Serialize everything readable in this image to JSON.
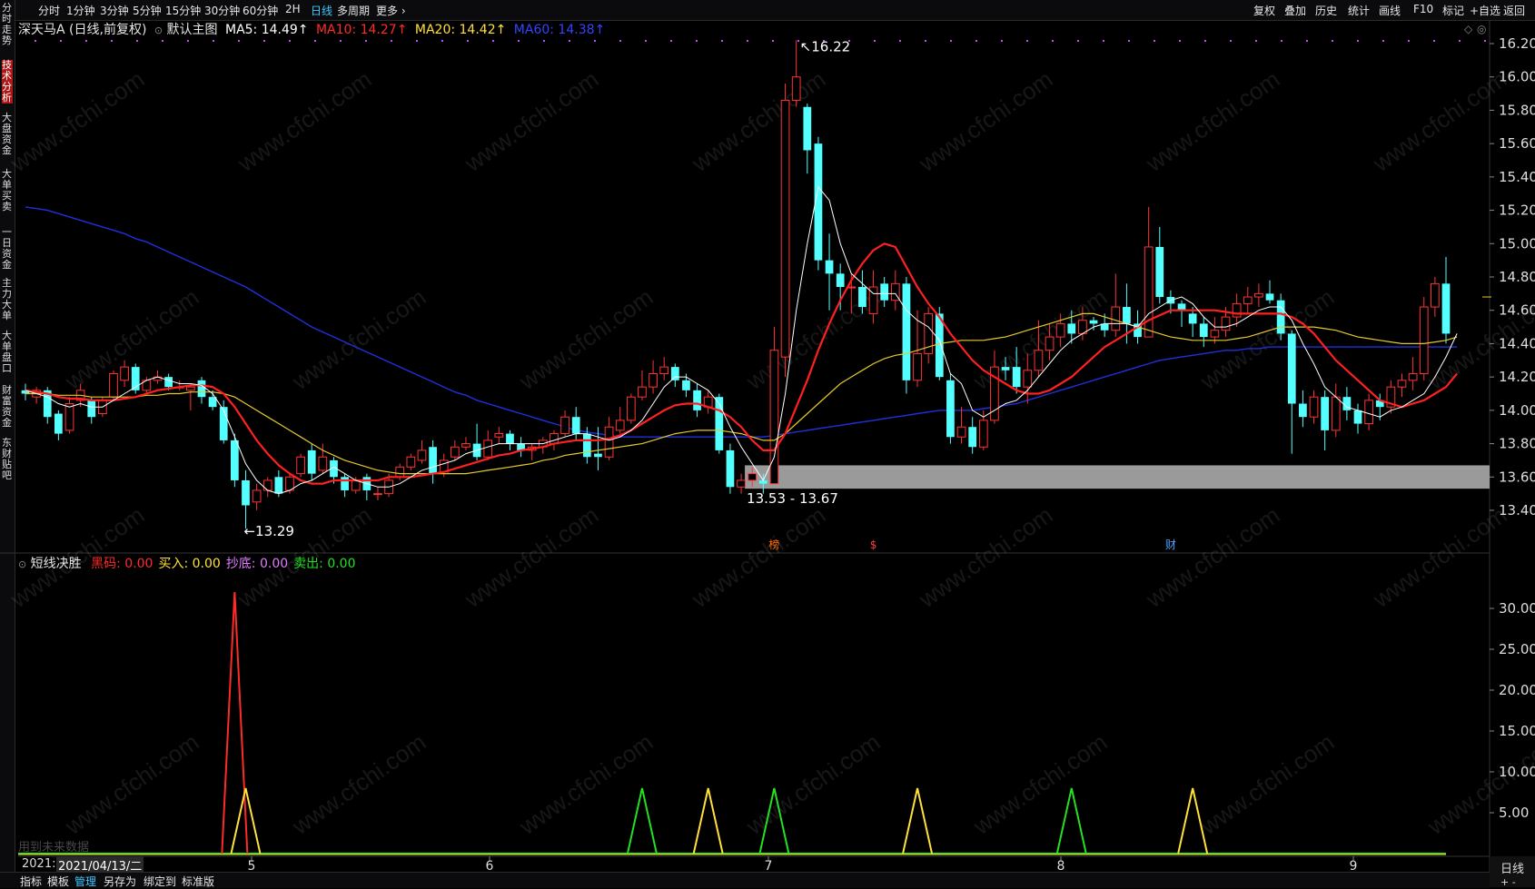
{
  "topbar": {
    "left_items": [
      "分时",
      "1分钟",
      "3分钟",
      "5分钟",
      "15分钟",
      "30分钟",
      "60分钟",
      "2H",
      "日线",
      "多周期",
      "更多"
    ],
    "active": "日线",
    "right_items": [
      "复权",
      "叠加",
      "历史",
      "统计",
      "画线",
      "F10",
      "标记",
      "+自选",
      "返回"
    ]
  },
  "left_tabs": [
    "分时走势",
    "技术分析",
    "大盘资金",
    "大单买卖",
    "一日资金",
    "主力大单",
    "大单盘口",
    "财富资金",
    "东财贴吧"
  ],
  "left_active": "技术分析",
  "main": {
    "stock_label": "深天马A (日线,前复权)",
    "indicator_label": "默认主图",
    "ma": [
      {
        "text": "MA5: 14.49↑",
        "color": "#ffffff"
      },
      {
        "text": "MA10: 14.27↑",
        "color": "#ff2a2a"
      },
      {
        "text": "MA20: 14.42↑",
        "color": "#ffe13a"
      },
      {
        "text": "MA60: 14.38↑",
        "color": "#3344ff"
      }
    ],
    "high_label": "16.22",
    "low_label": "13.29",
    "gap_label": "13.53 - 13.67",
    "badges": [
      {
        "text": "榜",
        "color": "#ff6a00"
      },
      {
        "text": "$",
        "color": "#ff3b3b"
      },
      {
        "text": "财",
        "color": "#4da3ff"
      }
    ]
  },
  "sub": {
    "name": "短线决胜",
    "items": [
      {
        "text": "黑码: 0.00",
        "color": "#ff2a2a"
      },
      {
        "text": "买入: 0.00",
        "color": "#ffe13a"
      },
      {
        "text": "抄底: 0.00",
        "color": "#e07cff"
      },
      {
        "text": "卖出: 0.00",
        "color": "#22e022"
      }
    ],
    "future_note": "用到未来数据"
  },
  "xaxis": {
    "date": "2021/04/13/二",
    "date_prefix": "2021:",
    "months": [
      "5",
      "6",
      "7",
      "8",
      "9"
    ]
  },
  "right_period": "日线",
  "bottom": [
    "指标",
    "模板",
    "管理",
    "另存为",
    "绑定到",
    "标准版"
  ],
  "bottom_selected": "管理",
  "watermark": "www.cfchi.com",
  "chart_data": {
    "type": "candlestick",
    "price_ticks": [
      16.2,
      16.0,
      15.8,
      15.6,
      15.4,
      15.2,
      15.0,
      14.8,
      14.6,
      14.4,
      14.2,
      14.0,
      13.8,
      13.6,
      13.4
    ],
    "sub_ticks": [
      30,
      25,
      20,
      15,
      10,
      5
    ],
    "candles": [
      [
        14.12,
        14.1,
        14.16,
        14.06
      ],
      [
        14.08,
        14.12,
        14.14,
        14.04
      ],
      [
        14.12,
        13.96,
        14.14,
        13.92
      ],
      [
        13.98,
        13.86,
        14.0,
        13.82
      ],
      [
        13.88,
        14.04,
        14.08,
        13.86
      ],
      [
        14.06,
        14.12,
        14.16,
        14.02
      ],
      [
        14.06,
        13.96,
        14.08,
        13.92
      ],
      [
        13.98,
        14.06,
        14.08,
        13.96
      ],
      [
        14.08,
        14.22,
        14.24,
        14.06
      ],
      [
        14.18,
        14.26,
        14.3,
        14.14
      ],
      [
        14.26,
        14.12,
        14.28,
        14.1
      ],
      [
        14.12,
        14.18,
        14.2,
        14.1
      ],
      [
        14.18,
        14.2,
        14.24,
        14.16
      ],
      [
        14.2,
        14.14,
        14.22,
        14.12
      ],
      [
        14.14,
        14.14,
        14.18,
        14.12
      ],
      [
        14.12,
        14.14,
        14.16,
        14.0
      ],
      [
        14.18,
        14.08,
        14.2,
        14.04
      ],
      [
        14.08,
        14.02,
        14.12,
        14.0
      ],
      [
        14.02,
        13.82,
        14.06,
        13.8
      ],
      [
        13.82,
        13.58,
        13.86,
        13.54
      ],
      [
        13.58,
        13.43,
        13.64,
        13.29
      ],
      [
        13.45,
        13.52,
        13.56,
        13.4
      ],
      [
        13.52,
        13.58,
        13.6,
        13.48
      ],
      [
        13.6,
        13.5,
        13.64,
        13.48
      ],
      [
        13.52,
        13.6,
        13.62,
        13.5
      ],
      [
        13.62,
        13.72,
        13.74,
        13.6
      ],
      [
        13.76,
        13.62,
        13.8,
        13.58
      ],
      [
        13.64,
        13.72,
        13.8,
        13.62
      ],
      [
        13.7,
        13.6,
        13.72,
        13.56
      ],
      [
        13.6,
        13.52,
        13.62,
        13.48
      ],
      [
        13.52,
        13.58,
        13.6,
        13.5
      ],
      [
        13.6,
        13.52,
        13.62,
        13.46
      ],
      [
        13.5,
        13.5,
        13.54,
        13.46
      ],
      [
        13.5,
        13.58,
        13.62,
        13.48
      ],
      [
        13.6,
        13.66,
        13.68,
        13.58
      ],
      [
        13.66,
        13.72,
        13.74,
        13.64
      ],
      [
        13.7,
        13.76,
        13.82,
        13.68
      ],
      [
        13.78,
        13.62,
        13.82,
        13.56
      ],
      [
        13.62,
        13.7,
        13.74,
        13.6
      ],
      [
        13.72,
        13.78,
        13.82,
        13.7
      ],
      [
        13.78,
        13.8,
        13.84,
        13.76
      ],
      [
        13.8,
        13.72,
        13.92,
        13.7
      ],
      [
        13.72,
        13.82,
        13.88,
        13.7
      ],
      [
        13.84,
        13.86,
        13.9,
        13.8
      ],
      [
        13.86,
        13.8,
        13.88,
        13.76
      ],
      [
        13.8,
        13.76,
        13.84,
        13.72
      ],
      [
        13.76,
        13.78,
        13.8,
        13.7
      ],
      [
        13.78,
        13.82,
        13.84,
        13.74
      ],
      [
        13.8,
        13.86,
        13.88,
        13.76
      ],
      [
        13.86,
        13.96,
        14.0,
        13.84
      ],
      [
        13.96,
        13.86,
        14.02,
        13.82
      ],
      [
        13.86,
        13.72,
        13.9,
        13.68
      ],
      [
        13.74,
        13.72,
        13.9,
        13.64
      ],
      [
        13.72,
        13.9,
        13.96,
        13.7
      ],
      [
        13.88,
        13.94,
        14.02,
        13.86
      ],
      [
        13.94,
        14.08,
        14.1,
        13.92
      ],
      [
        14.08,
        14.14,
        14.24,
        14.06
      ],
      [
        14.14,
        14.22,
        14.3,
        14.1
      ],
      [
        14.22,
        14.26,
        14.32,
        14.18
      ],
      [
        14.26,
        14.18,
        14.28,
        14.14
      ],
      [
        14.18,
        14.12,
        14.22,
        14.08
      ],
      [
        14.12,
        14.0,
        14.16,
        13.96
      ],
      [
        14.02,
        14.08,
        14.12,
        13.98
      ],
      [
        14.08,
        13.76,
        14.1,
        13.74
      ],
      [
        13.76,
        13.54,
        13.8,
        13.5
      ],
      [
        13.54,
        13.58,
        13.62,
        13.5
      ],
      [
        13.58,
        13.62,
        13.66,
        13.54
      ],
      [
        13.58,
        13.56,
        13.62,
        13.5
      ],
      [
        13.56,
        14.36,
        14.5,
        13.56
      ],
      [
        14.32,
        15.86,
        15.96,
        14.2
      ],
      [
        15.86,
        16.0,
        16.22,
        15.82
      ],
      [
        15.82,
        15.56,
        15.84,
        15.42
      ],
      [
        15.6,
        14.9,
        15.64,
        14.84
      ],
      [
        14.9,
        14.82,
        15.06,
        14.6
      ],
      [
        14.82,
        14.74,
        14.88,
        14.6
      ],
      [
        14.74,
        14.74,
        14.82,
        14.58
      ],
      [
        14.74,
        14.62,
        14.84,
        14.58
      ],
      [
        14.58,
        14.74,
        14.84,
        14.52
      ],
      [
        14.76,
        14.66,
        14.8,
        14.62
      ],
      [
        14.66,
        14.76,
        14.84,
        14.6
      ],
      [
        14.76,
        14.18,
        14.8,
        14.1
      ],
      [
        14.18,
        14.34,
        14.6,
        14.14
      ],
      [
        14.34,
        14.58,
        14.62,
        14.28
      ],
      [
        14.58,
        14.2,
        14.62,
        14.18
      ],
      [
        14.18,
        13.84,
        14.22,
        13.8
      ],
      [
        13.84,
        13.9,
        14.02,
        13.8
      ],
      [
        13.9,
        13.78,
        13.96,
        13.74
      ],
      [
        13.78,
        13.94,
        14.0,
        13.76
      ],
      [
        13.94,
        14.26,
        14.36,
        13.92
      ],
      [
        14.26,
        14.24,
        14.32,
        14.18
      ],
      [
        14.26,
        14.14,
        14.38,
        14.1
      ],
      [
        14.14,
        14.24,
        14.34,
        14.04
      ],
      [
        14.24,
        14.36,
        14.54,
        14.2
      ],
      [
        14.36,
        14.44,
        14.52,
        14.3
      ],
      [
        14.44,
        14.52,
        14.58,
        14.38
      ],
      [
        14.52,
        14.46,
        14.6,
        14.4
      ],
      [
        14.46,
        14.54,
        14.62,
        14.42
      ],
      [
        14.54,
        14.52,
        14.56,
        14.48
      ],
      [
        14.52,
        14.48,
        14.58,
        14.44
      ],
      [
        14.48,
        14.62,
        14.82,
        14.44
      ],
      [
        14.62,
        14.52,
        14.76,
        14.4
      ],
      [
        14.52,
        14.44,
        14.6,
        14.4
      ],
      [
        14.44,
        14.98,
        15.22,
        14.44
      ],
      [
        14.98,
        14.68,
        15.1,
        14.64
      ],
      [
        14.68,
        14.64,
        14.72,
        14.58
      ],
      [
        14.64,
        14.6,
        14.66,
        14.5
      ],
      [
        14.58,
        14.52,
        14.62,
        14.44
      ],
      [
        14.52,
        14.44,
        14.56,
        14.38
      ],
      [
        14.44,
        14.48,
        14.56,
        14.4
      ],
      [
        14.48,
        14.56,
        14.62,
        14.44
      ],
      [
        14.56,
        14.64,
        14.7,
        14.5
      ],
      [
        14.64,
        14.68,
        14.74,
        14.58
      ],
      [
        14.68,
        14.7,
        14.76,
        14.62
      ],
      [
        14.7,
        14.66,
        14.78,
        14.64
      ],
      [
        14.66,
        14.46,
        14.7,
        14.42
      ],
      [
        14.46,
        14.04,
        14.48,
        13.74
      ],
      [
        14.04,
        13.96,
        14.12,
        13.9
      ],
      [
        13.96,
        14.08,
        14.12,
        13.92
      ],
      [
        14.08,
        13.88,
        14.12,
        13.76
      ],
      [
        13.88,
        14.08,
        14.16,
        13.84
      ],
      [
        14.08,
        14.0,
        14.14,
        13.94
      ],
      [
        14.0,
        13.92,
        14.04,
        13.86
      ],
      [
        13.92,
        14.06,
        14.1,
        13.88
      ],
      [
        14.06,
        14.02,
        14.1,
        13.94
      ],
      [
        14.02,
        14.14,
        14.18,
        13.98
      ],
      [
        14.14,
        14.18,
        14.22,
        14.08
      ],
      [
        14.18,
        14.22,
        14.32,
        14.12
      ],
      [
        14.22,
        14.62,
        14.68,
        14.18
      ],
      [
        14.62,
        14.76,
        14.8,
        14.56
      ],
      [
        14.76,
        14.46,
        14.92,
        14.4
      ]
    ],
    "ma5": [
      14.12,
      14.1,
      14.08,
      14.04,
      14.02,
      14.04,
      14.02,
      14.02,
      14.06,
      14.1,
      14.14,
      14.18,
      14.2,
      14.18,
      14.16,
      14.16,
      14.15,
      14.1,
      14.0,
      13.84,
      13.68,
      13.58,
      13.52,
      13.5,
      13.52,
      13.56,
      13.58,
      13.62,
      13.66,
      13.62,
      13.58,
      13.56,
      13.54,
      13.54,
      13.56,
      13.6,
      13.64,
      13.66,
      13.68,
      13.7,
      13.74,
      13.76,
      13.78,
      13.8,
      13.8,
      13.8,
      13.8,
      13.8,
      13.82,
      13.84,
      13.86,
      13.86,
      13.84,
      13.82,
      13.84,
      13.88,
      13.94,
      14.04,
      14.14,
      14.2,
      14.2,
      14.16,
      14.12,
      14.04,
      13.9,
      13.78,
      13.68,
      13.58,
      13.72,
      14.1,
      14.6,
      15.0,
      15.34,
      15.26,
      15.0,
      14.82,
      14.76,
      14.7,
      14.7,
      14.7,
      14.6,
      14.54,
      14.5,
      14.42,
      14.22,
      14.16,
      14.0,
      13.96,
      14.0,
      14.04,
      14.06,
      14.12,
      14.2,
      14.28,
      14.36,
      14.42,
      14.46,
      14.5,
      14.52,
      14.52,
      14.52,
      14.5,
      14.58,
      14.62,
      14.66,
      14.68,
      14.64,
      14.56,
      14.5,
      14.5,
      14.52,
      14.56,
      14.6,
      14.62,
      14.62,
      14.54,
      14.4,
      14.28,
      14.14,
      14.08,
      14.02,
      14.0,
      13.98,
      13.96,
      14.0,
      14.02,
      14.06,
      14.1,
      14.2,
      14.32,
      14.46
    ],
    "ma10": [
      14.12,
      14.11,
      14.1,
      14.08,
      14.07,
      14.07,
      14.06,
      14.06,
      14.06,
      14.07,
      14.08,
      14.1,
      14.12,
      14.13,
      14.14,
      14.15,
      14.15,
      14.14,
      14.1,
      14.02,
      13.92,
      13.82,
      13.74,
      13.67,
      13.62,
      13.58,
      13.56,
      13.56,
      13.58,
      13.58,
      13.58,
      13.58,
      13.58,
      13.6,
      13.6,
      13.6,
      13.61,
      13.62,
      13.63,
      13.65,
      13.67,
      13.69,
      13.71,
      13.73,
      13.74,
      13.76,
      13.77,
      13.78,
      13.8,
      13.81,
      13.82,
      13.82,
      13.82,
      13.83,
      13.85,
      13.88,
      13.92,
      13.96,
      14.0,
      14.03,
      14.04,
      14.04,
      14.02,
      14.0,
      13.96,
      13.9,
      13.82,
      13.76,
      13.76,
      13.86,
      14.02,
      14.18,
      14.36,
      14.52,
      14.66,
      14.78,
      14.88,
      14.96,
      15.0,
      14.98,
      14.86,
      14.74,
      14.64,
      14.56,
      14.46,
      14.38,
      14.3,
      14.24,
      14.2,
      14.16,
      14.12,
      14.1,
      14.1,
      14.12,
      14.16,
      14.2,
      14.26,
      14.32,
      14.38,
      14.42,
      14.46,
      14.5,
      14.54,
      14.57,
      14.6,
      14.6,
      14.6,
      14.6,
      14.6,
      14.59,
      14.58,
      14.58,
      14.58,
      14.58,
      14.58,
      14.56,
      14.52,
      14.46,
      14.38,
      14.3,
      14.24,
      14.18,
      14.12,
      14.06,
      14.04,
      14.02,
      14.04,
      14.06,
      14.1,
      14.14,
      14.22
    ],
    "ma20": [
      14.1,
      14.1,
      14.1,
      14.09,
      14.09,
      14.09,
      14.08,
      14.08,
      14.08,
      14.08,
      14.08,
      14.09,
      14.09,
      14.1,
      14.1,
      14.11,
      14.11,
      14.11,
      14.1,
      14.08,
      14.04,
      14.0,
      13.96,
      13.92,
      13.88,
      13.84,
      13.8,
      13.76,
      13.73,
      13.7,
      13.68,
      13.66,
      13.64,
      13.63,
      13.62,
      13.62,
      13.62,
      13.62,
      13.62,
      13.62,
      13.62,
      13.63,
      13.64,
      13.65,
      13.66,
      13.67,
      13.68,
      13.7,
      13.71,
      13.73,
      13.74,
      13.75,
      13.76,
      13.77,
      13.78,
      13.79,
      13.8,
      13.82,
      13.84,
      13.86,
      13.87,
      13.88,
      13.88,
      13.88,
      13.87,
      13.86,
      13.84,
      13.82,
      13.82,
      13.86,
      13.92,
      13.98,
      14.04,
      14.1,
      14.16,
      14.2,
      14.24,
      14.28,
      14.31,
      14.33,
      14.34,
      14.36,
      14.38,
      14.4,
      14.41,
      14.42,
      14.42,
      14.42,
      14.43,
      14.44,
      14.46,
      14.48,
      14.5,
      14.52,
      14.54,
      14.56,
      14.58,
      14.58,
      14.56,
      14.54,
      14.52,
      14.5,
      14.48,
      14.46,
      14.44,
      14.43,
      14.42,
      14.42,
      14.42,
      14.42,
      14.43,
      14.44,
      14.46,
      14.48,
      14.5,
      14.5,
      14.5,
      14.5,
      14.49,
      14.48,
      14.46,
      14.44,
      14.43,
      14.42,
      14.41,
      14.4,
      14.4,
      14.4,
      14.41,
      14.42,
      14.44
    ],
    "ma60": [
      15.22,
      15.21,
      15.2,
      15.18,
      15.16,
      15.14,
      15.12,
      15.1,
      15.08,
      15.06,
      15.03,
      15.01,
      14.98,
      14.95,
      14.92,
      14.89,
      14.86,
      14.83,
      14.8,
      14.77,
      14.74,
      14.7,
      14.66,
      14.62,
      14.58,
      14.54,
      14.5,
      14.47,
      14.44,
      14.41,
      14.38,
      14.35,
      14.32,
      14.29,
      14.26,
      14.23,
      14.2,
      14.17,
      14.14,
      14.11,
      14.09,
      14.06,
      14.04,
      14.02,
      14.0,
      13.98,
      13.96,
      13.94,
      13.92,
      13.9,
      13.88,
      13.87,
      13.86,
      13.85,
      13.84,
      13.84,
      13.84,
      13.84,
      13.84,
      13.84,
      13.84,
      13.84,
      13.84,
      13.84,
      13.84,
      13.84,
      13.84,
      13.84,
      13.85,
      13.86,
      13.87,
      13.88,
      13.89,
      13.9,
      13.91,
      13.92,
      13.93,
      13.94,
      13.95,
      13.96,
      13.97,
      13.98,
      13.99,
      14.0,
      14.0,
      14.0,
      14.0,
      14.01,
      14.02,
      14.03,
      14.04,
      14.06,
      14.08,
      14.1,
      14.12,
      14.14,
      14.16,
      14.18,
      14.2,
      14.22,
      14.24,
      14.26,
      14.28,
      14.3,
      14.31,
      14.32,
      14.33,
      14.34,
      14.35,
      14.36,
      14.36,
      14.37,
      14.37,
      14.38,
      14.38,
      14.38,
      14.38,
      14.38,
      14.38,
      14.38,
      14.38,
      14.38,
      14.38,
      14.38,
      14.38,
      14.38,
      14.38,
      14.38,
      14.38,
      14.38,
      14.38
    ],
    "gap_zone": [
      13.53,
      13.67
    ],
    "signals": [
      {
        "idx": 19,
        "height": 32,
        "color": "#ff2a2a"
      },
      {
        "idx": 20,
        "height": 8,
        "color": "#ffe13a"
      },
      {
        "idx": 56,
        "height": 8,
        "color": "#22e022"
      },
      {
        "idx": 62,
        "height": 8,
        "color": "#ffe13a"
      },
      {
        "idx": 68,
        "height": 8,
        "color": "#22e022"
      },
      {
        "idx": 81,
        "height": 8,
        "color": "#ffe13a"
      },
      {
        "idx": 95,
        "height": 8,
        "color": "#22e022"
      },
      {
        "idx": 106,
        "height": 8,
        "color": "#ffe13a"
      }
    ]
  }
}
